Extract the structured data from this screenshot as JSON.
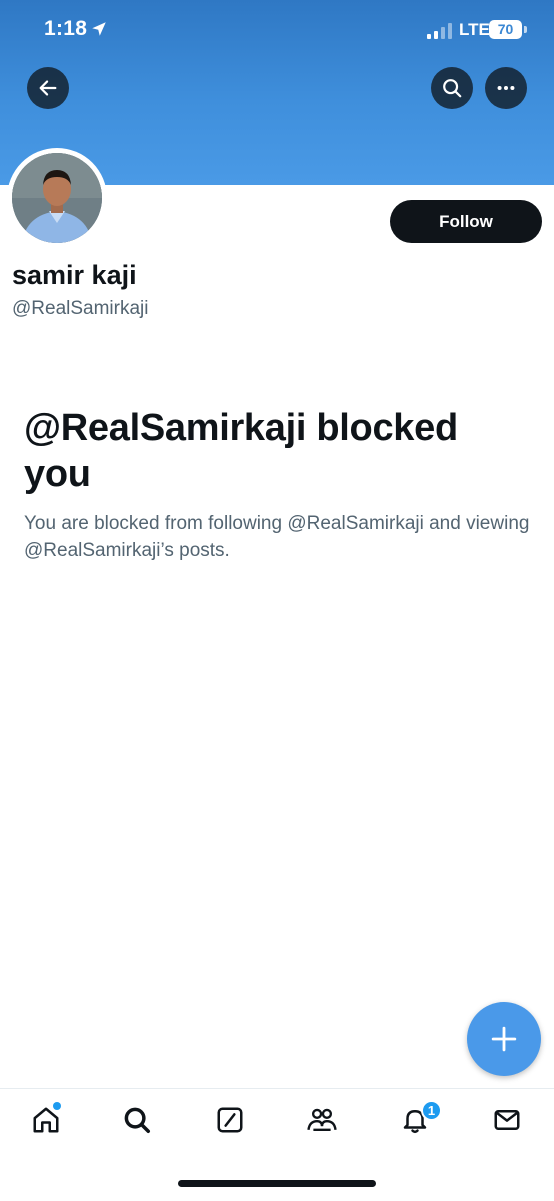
{
  "status_bar": {
    "time": "1:18",
    "network": "LTE",
    "battery": "70"
  },
  "profile": {
    "display_name": "samir kaji",
    "handle": "@RealSamirkaji",
    "follow_label": "Follow"
  },
  "blocked": {
    "title": "@RealSamirkaji blocked you",
    "description": "You are blocked from following @RealSamirkaji and viewing @RealSamirkaji’s posts."
  },
  "tabbar": {
    "items": [
      "home-icon",
      "search-icon",
      "grok-icon",
      "communities-icon",
      "notifications-icon",
      "messages-icon"
    ],
    "notification_count": "1"
  },
  "icons": {
    "back": "arrow-left-icon",
    "search": "search-icon",
    "more": "more-icon",
    "compose": "plus-icon"
  },
  "colors": {
    "accent": "#1d9bf0",
    "fab": "#4a99e9",
    "banner": "#3f8fdc"
  }
}
